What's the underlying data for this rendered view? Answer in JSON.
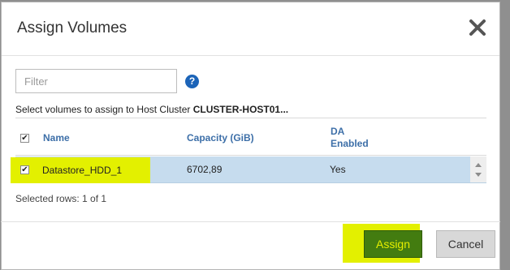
{
  "dialog": {
    "title": "Assign Volumes",
    "close_icon": "close-icon"
  },
  "filter": {
    "placeholder": "Filter",
    "value": "",
    "help_icon": "help-icon",
    "help_glyph": "?"
  },
  "instruction": {
    "prefix": "Select volumes to assign to Host Cluster ",
    "host": "CLUSTER-HOST01..."
  },
  "table": {
    "header_checkbox_checked": true,
    "columns": {
      "name": "Name",
      "capacity": "Capacity (GiB)",
      "da_line1": "DA",
      "da_line2": "Enabled"
    },
    "rows": [
      {
        "checked": true,
        "name": "Datastore_HDD_1",
        "capacity": "6702,89",
        "da_enabled": "Yes"
      }
    ],
    "selected_summary": "Selected rows: 1 of 1",
    "checkmark": "✔"
  },
  "footer": {
    "assign_label": "Assign",
    "cancel_label": "Cancel"
  },
  "colors": {
    "highlight": "#e3f000",
    "assign_bg": "#437c10",
    "row_selected_bg": "#c6dcee",
    "header_text": "#3d6fa8"
  }
}
